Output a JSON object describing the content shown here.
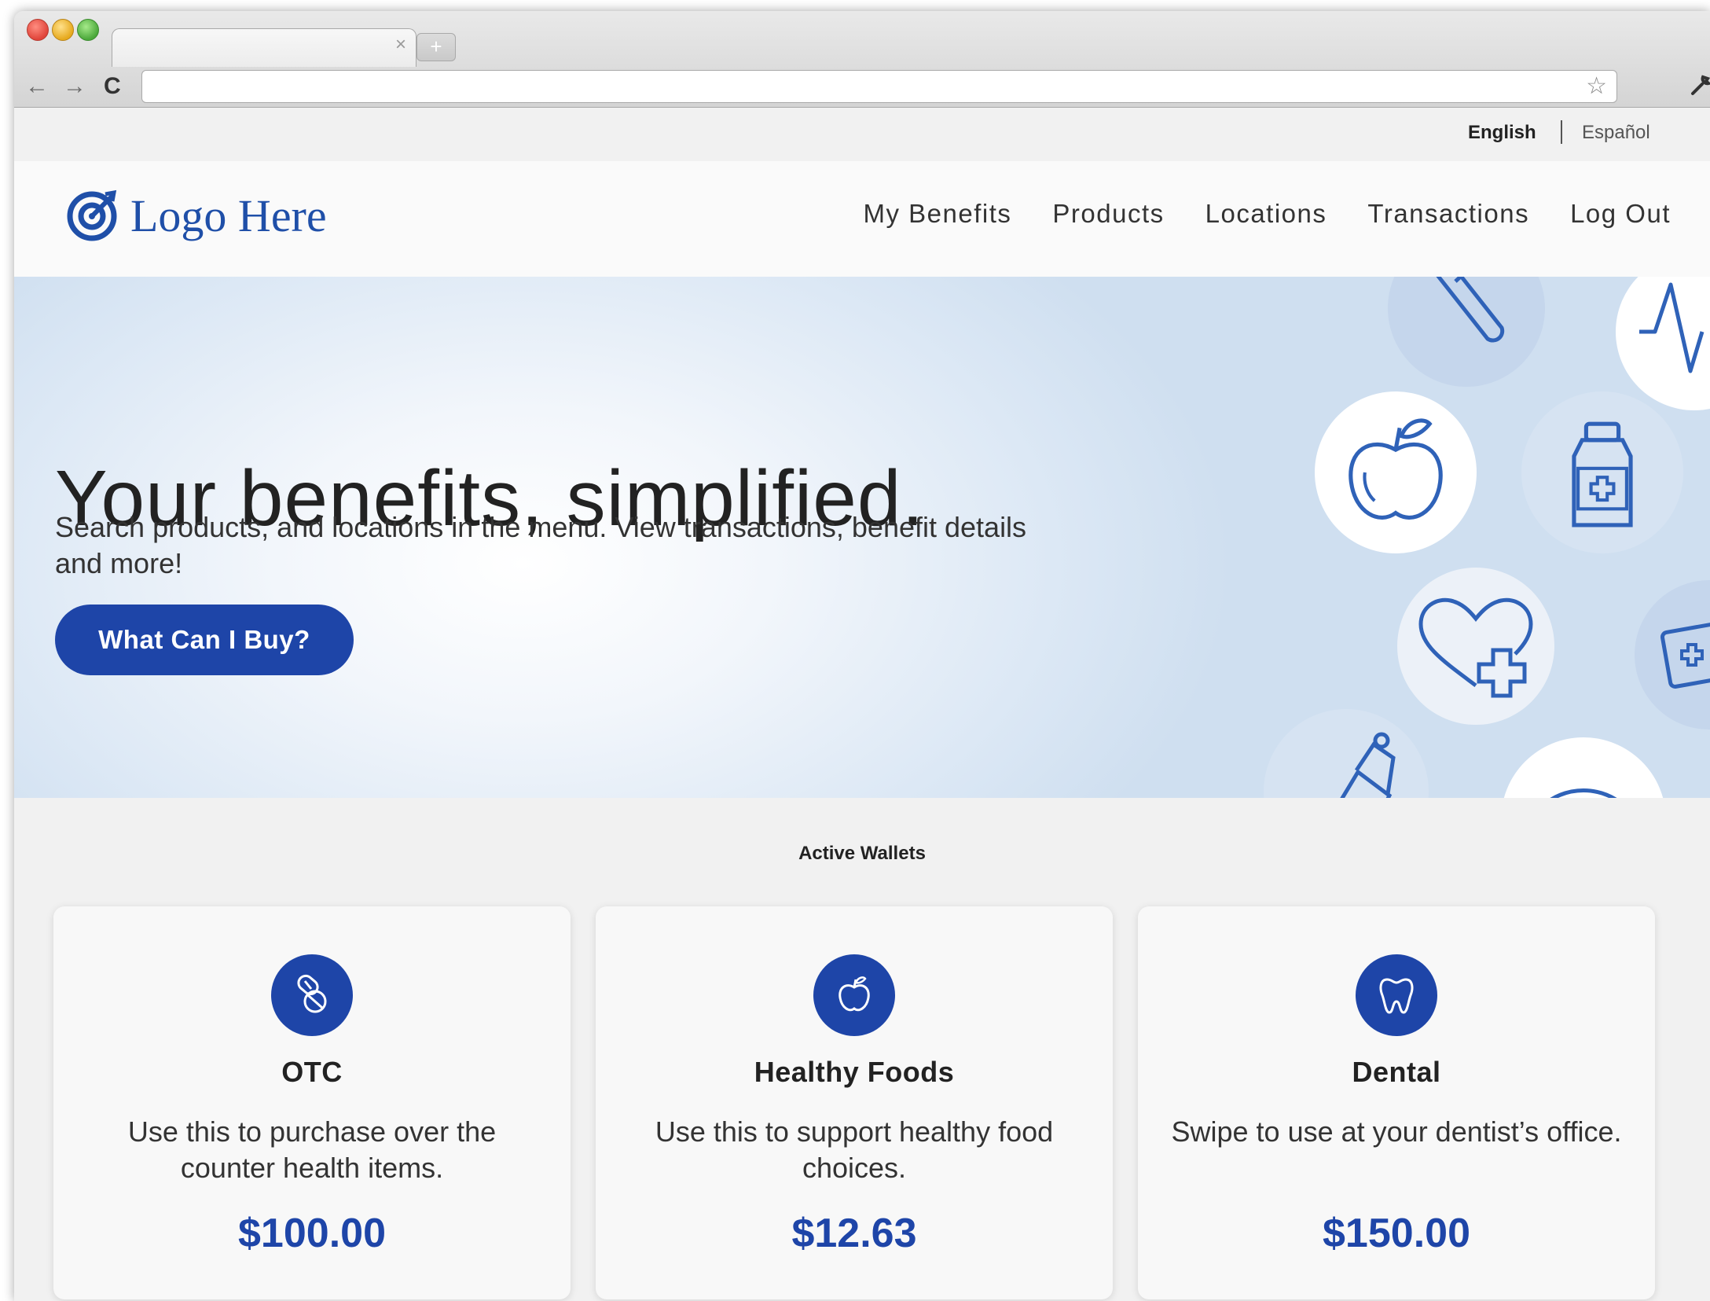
{
  "browser": {
    "tab_close": "×",
    "new_tab": "+",
    "back": "←",
    "forward": "→",
    "reload": "C",
    "star": "☆",
    "wrench": "🔧"
  },
  "language": {
    "english": "English",
    "spanish": "Español"
  },
  "header": {
    "logo_text": "Logo Here",
    "nav": [
      "My Benefits",
      "Products",
      "Locations",
      "Transactions",
      "Log Out"
    ]
  },
  "hero": {
    "title": "Your benefits, simplified.",
    "subtitle": "Search products, and locations in the menu. View transactions, benefit details and more!",
    "cta": "What Can I Buy?"
  },
  "wallets": {
    "title": "Active Wallets",
    "items": [
      {
        "icon": "pills-icon",
        "name": "OTC",
        "description": "Use this to purchase over the counter health items.",
        "amount": "$100.00"
      },
      {
        "icon": "apple-icon",
        "name": "Healthy Foods",
        "description": "Use this to support healthy food choices.",
        "amount": "$12.63"
      },
      {
        "icon": "tooth-icon",
        "name": "Dental",
        "description": "Swipe to use at your dentist’s office.",
        "amount": "$150.00"
      }
    ]
  },
  "colors": {
    "brand": "#1e45a8",
    "logo": "#1f4fa8",
    "icon_line": "#3b6fc4"
  }
}
